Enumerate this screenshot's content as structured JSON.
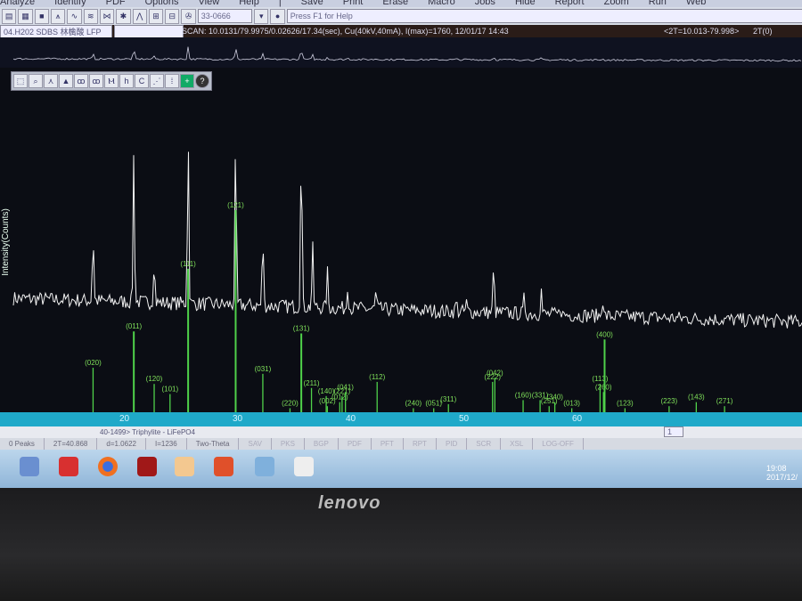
{
  "menubar": {
    "items": [
      "Analyze",
      "Identify",
      "PDF",
      "Options",
      "View",
      "Help",
      "|",
      "Save",
      "Print",
      "Erase",
      "Macro",
      "Jobs",
      "Hide",
      "Report",
      "Zoom",
      "Run",
      "Web"
    ]
  },
  "toolbar": {
    "pdf_combo": "33-0666 (Phos",
    "help_hint": "Press F1 for Help",
    "file_combo": "04.H202 SDBS 林檎酸 LFP 11"
  },
  "scan_info": "SCAN: 10.0131/79.9975/0.02626/17.34(sec), Cu(40kV,40mA), I(max)=1760, 12/01/17 14:43",
  "range_info": "<2T=10.013-79.998>",
  "range_toggle": "2T(0)",
  "y_axis_label": "Intensity(Counts)",
  "reference_card": "40-1499> Triphylite - LiFePO4",
  "status": {
    "peaks": "0 Peaks",
    "two_theta": "2T=40.868",
    "d": "d=1.0622",
    "i": "I=1236",
    "mode": "Two-Theta",
    "flags": [
      "SAV",
      "PKS",
      "BGP",
      "PDF",
      "PFT",
      "RPT",
      "PID",
      "SCR",
      "XSL",
      "LOG-OFF"
    ]
  },
  "page_field": "1",
  "clock": {
    "time": "19:08",
    "date": "2017/12/"
  },
  "brand": "lenovo",
  "colors": {
    "trace": "#f2f2f2",
    "sticks": "#4fd14a",
    "axis": "#1fa9c9"
  },
  "chart_data": {
    "type": "line",
    "xlabel": "",
    "ylabel": "Intensity(Counts)",
    "xlim": [
      10,
      80
    ],
    "x_ticks": [
      20,
      30,
      40,
      50,
      60
    ],
    "observed_peaks": {
      "two_theta": [
        17.2,
        20.8,
        22.6,
        25.6,
        29.8,
        32.2,
        35.6,
        36.6,
        37.9,
        39.7,
        42.2,
        49.3,
        50.2,
        52.6,
        55.3,
        56.8,
        58.5,
        62.2
      ],
      "relative_intensity": [
        39,
        86,
        25,
        98,
        95,
        40,
        100,
        35,
        21,
        14,
        10,
        6,
        5,
        27,
        9,
        14,
        5,
        11
      ]
    },
    "reference_sticks": [
      {
        "hkl": "(020)",
        "two_theta": 17.2,
        "i": 22
      },
      {
        "hkl": "(011)",
        "two_theta": 20.8,
        "i": 40
      },
      {
        "hkl": "(120)",
        "two_theta": 22.6,
        "i": 14
      },
      {
        "hkl": "(101)",
        "two_theta": 24.0,
        "i": 9
      },
      {
        "hkl": "(111)",
        "two_theta": 25.6,
        "i": 71
      },
      {
        "hkl": "(121)",
        "two_theta": 29.8,
        "i": 100
      },
      {
        "hkl": "(031)",
        "two_theta": 32.2,
        "i": 19
      },
      {
        "hkl": "(220)",
        "two_theta": 34.6,
        "i": 2
      },
      {
        "hkl": "(131)",
        "two_theta": 35.6,
        "i": 39
      },
      {
        "hkl": "(211)",
        "two_theta": 36.5,
        "i": 12
      },
      {
        "hkl": "(140)",
        "two_theta": 37.8,
        "i": 8
      },
      {
        "hkl": "(002)",
        "two_theta": 37.9,
        "i": 3
      },
      {
        "hkl": "(012)",
        "two_theta": 39.0,
        "i": 5
      },
      {
        "hkl": "(221)",
        "two_theta": 39.2,
        "i": 8
      },
      {
        "hkl": "(041)",
        "two_theta": 39.5,
        "i": 10
      },
      {
        "hkl": "(112)",
        "two_theta": 42.3,
        "i": 15
      },
      {
        "hkl": "(240)",
        "two_theta": 45.5,
        "i": 2
      },
      {
        "hkl": "(051)",
        "two_theta": 47.3,
        "i": 2
      },
      {
        "hkl": "(311)",
        "two_theta": 48.6,
        "i": 4
      },
      {
        "hkl": "(222)",
        "two_theta": 52.5,
        "i": 15
      },
      {
        "hkl": "(042)",
        "two_theta": 52.7,
        "i": 17
      },
      {
        "hkl": "(160)",
        "two_theta": 55.2,
        "i": 6
      },
      {
        "hkl": "(331)",
        "two_theta": 56.7,
        "i": 6
      },
      {
        "hkl": "(251)",
        "two_theta": 57.5,
        "i": 3
      },
      {
        "hkl": "(340)",
        "two_theta": 58.0,
        "i": 5
      },
      {
        "hkl": "(013)",
        "two_theta": 59.5,
        "i": 2
      },
      {
        "hkl": "(113)",
        "two_theta": 62.0,
        "i": 14
      },
      {
        "hkl": "(260)",
        "two_theta": 62.3,
        "i": 10
      },
      {
        "hkl": "(400)",
        "two_theta": 62.4,
        "i": 36
      },
      {
        "hkl": "(123)",
        "two_theta": 64.2,
        "i": 2
      },
      {
        "hkl": "(223)",
        "two_theta": 68.1,
        "i": 3
      },
      {
        "hkl": "(143)",
        "two_theta": 70.5,
        "i": 5
      },
      {
        "hkl": "(271)",
        "two_theta": 73.0,
        "i": 3
      }
    ]
  }
}
